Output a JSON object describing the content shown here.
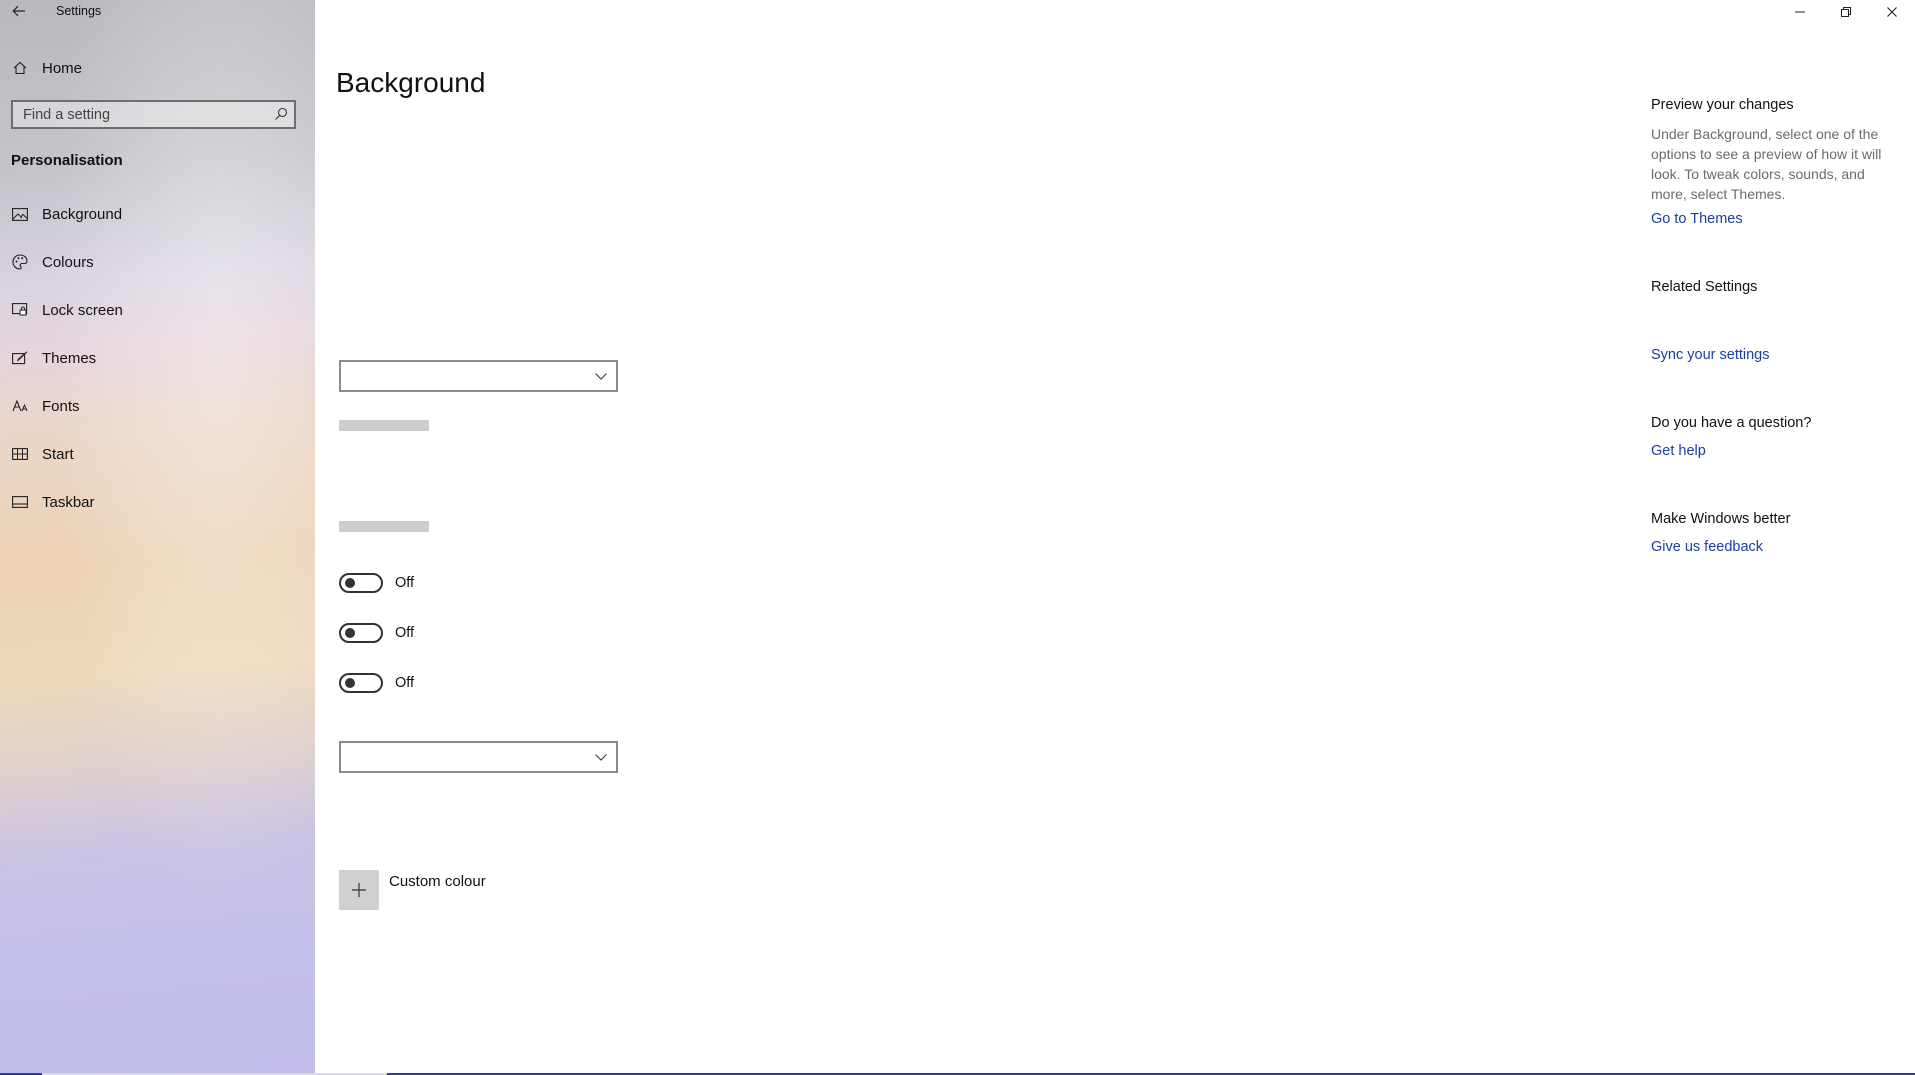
{
  "window": {
    "app_title": "Settings",
    "controls": {
      "minimize": "minimize-icon",
      "restore": "restore-icon",
      "close": "close-icon"
    }
  },
  "sidebar": {
    "home_label": "Home",
    "search_placeholder": "Find a setting",
    "section_title": "Personalisation",
    "items": [
      {
        "label": "Background",
        "icon": "picture-icon"
      },
      {
        "label": "Colours",
        "icon": "palette-icon"
      },
      {
        "label": "Lock screen",
        "icon": "lock-screen-icon"
      },
      {
        "label": "Themes",
        "icon": "brush-icon"
      },
      {
        "label": "Fonts",
        "icon": "font-icon"
      },
      {
        "label": "Start",
        "icon": "start-icon"
      },
      {
        "label": "Taskbar",
        "icon": "taskbar-icon"
      }
    ]
  },
  "main": {
    "title": "Background",
    "toggles": [
      {
        "state": "Off"
      },
      {
        "state": "Off"
      },
      {
        "state": "Off"
      }
    ],
    "custom_colour_label": "Custom colour"
  },
  "right_pane": {
    "preview_heading": "Preview your changes",
    "preview_text": "Under Background, select one of the options to see a preview of how it will look. To tweak colors, sounds, and more, select Themes.",
    "go_to_themes": "Go to Themes",
    "related_heading": "Related Settings",
    "sync_link": "Sync your settings",
    "question_heading": "Do you have a question?",
    "get_help": "Get help",
    "feedback_heading": "Make Windows better",
    "feedback_link": "Give us feedback"
  },
  "colors": {
    "link": "#1a3da6",
    "placeholder_bar": "#cccccc"
  }
}
